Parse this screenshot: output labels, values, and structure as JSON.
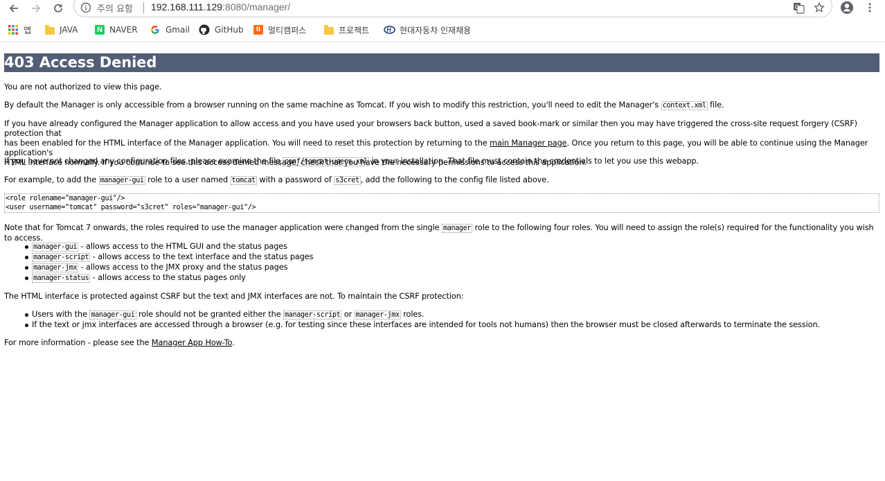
{
  "browser": {
    "security_label": "주의 요함",
    "url_host": "192.168.111.129",
    "url_path": ":8080/manager/",
    "bookmarks": [
      {
        "label": "앱",
        "icon": "apps-grid-icon"
      },
      {
        "label": "JAVA",
        "icon": "folder-icon"
      },
      {
        "label": "NAVER",
        "icon": "naver-icon"
      },
      {
        "label": "Gmail",
        "icon": "google-icon"
      },
      {
        "label": "GitHub",
        "icon": "github-icon"
      },
      {
        "label": "멀티캠퍼스",
        "icon": "multicampus-icon"
      },
      {
        "label": "프로젝트",
        "icon": "folder-icon"
      },
      {
        "label": "현대자동차 인재채용",
        "icon": "hyundai-icon"
      }
    ]
  },
  "page": {
    "title": "403 Access Denied",
    "p1": "You are not authorized to view this page.",
    "p2_a": "By default the Manager is only accessible from a browser running on the same machine as Tomcat. If you wish to modify this restriction, you'll need to edit the Manager's ",
    "p2_code": "context.xml",
    "p2_b": " file.",
    "p3_line1": "If you have already configured the Manager application to allow access and you have used your browsers back button, used a saved book-mark or similar then you may have triggered the cross-site request forgery (CSRF) protection that",
    "p3_line2_a": "has been enabled for the HTML interface of the Manager application. You will need to reset this protection by returning to the ",
    "p3_link": "main Manager page",
    "p3_line2_b": ". Once you return to this page, you will be able to continue using the Manager application's",
    "p3_line3": "HTML interface normally. If you continue to see this access denied message, check that you have the necessary permissions to access this application.",
    "p4_a": "If you have not changed any configuration files, please examine the file ",
    "p4_code": "conf/tomcat-users.xml",
    "p4_b": " in your installation. That file must contain the credentials to let you use this webapp.",
    "p5_a": "For example, to add the ",
    "p5_code1": "manager-gui",
    "p5_b": " role to a user named ",
    "p5_code2": "tomcat",
    "p5_c": " with a password of ",
    "p5_code3": "s3cret",
    "p5_d": ", add the following to the config file listed above.",
    "pre_line1": "<role rolename=\"manager-gui\"/>",
    "pre_line2": "<user username=\"tomcat\" password=\"s3cret\" roles=\"manager-gui\"/>",
    "p6_a": "Note that for Tomcat 7 onwards, the roles required to use the manager application were changed from the single ",
    "p6_code": "manager",
    "p6_b": " role to the following four roles. You will need to assign the role(s) required for the functionality you wish to access.",
    "roles": [
      {
        "code": "manager-gui",
        "text": " - allows access to the HTML GUI and the status pages"
      },
      {
        "code": "manager-script",
        "text": " - allows access to the text interface and the status pages"
      },
      {
        "code": "manager-jmx",
        "text": " - allows access to the JMX proxy and the status pages"
      },
      {
        "code": "manager-status",
        "text": " - allows access to the status pages only"
      }
    ],
    "p7": "The HTML interface is protected against CSRF but the text and JMX interfaces are not. To maintain the CSRF protection:",
    "csrf1_a": "Users with the ",
    "csrf1_code1": "manager-gui",
    "csrf1_b": " role should not be granted either the ",
    "csrf1_code2": "manager-script",
    "csrf1_c": " or ",
    "csrf1_code3": "manager-jmx",
    "csrf1_d": " roles.",
    "csrf2": "If the text or jmx interfaces are accessed through a browser (e.g. for testing since these interfaces are intended for tools not humans) then the browser must be closed afterwards to terminate the session.",
    "p8_a": "For more information - please see the ",
    "p8_link": "Manager App How-To",
    "p8_b": "."
  }
}
